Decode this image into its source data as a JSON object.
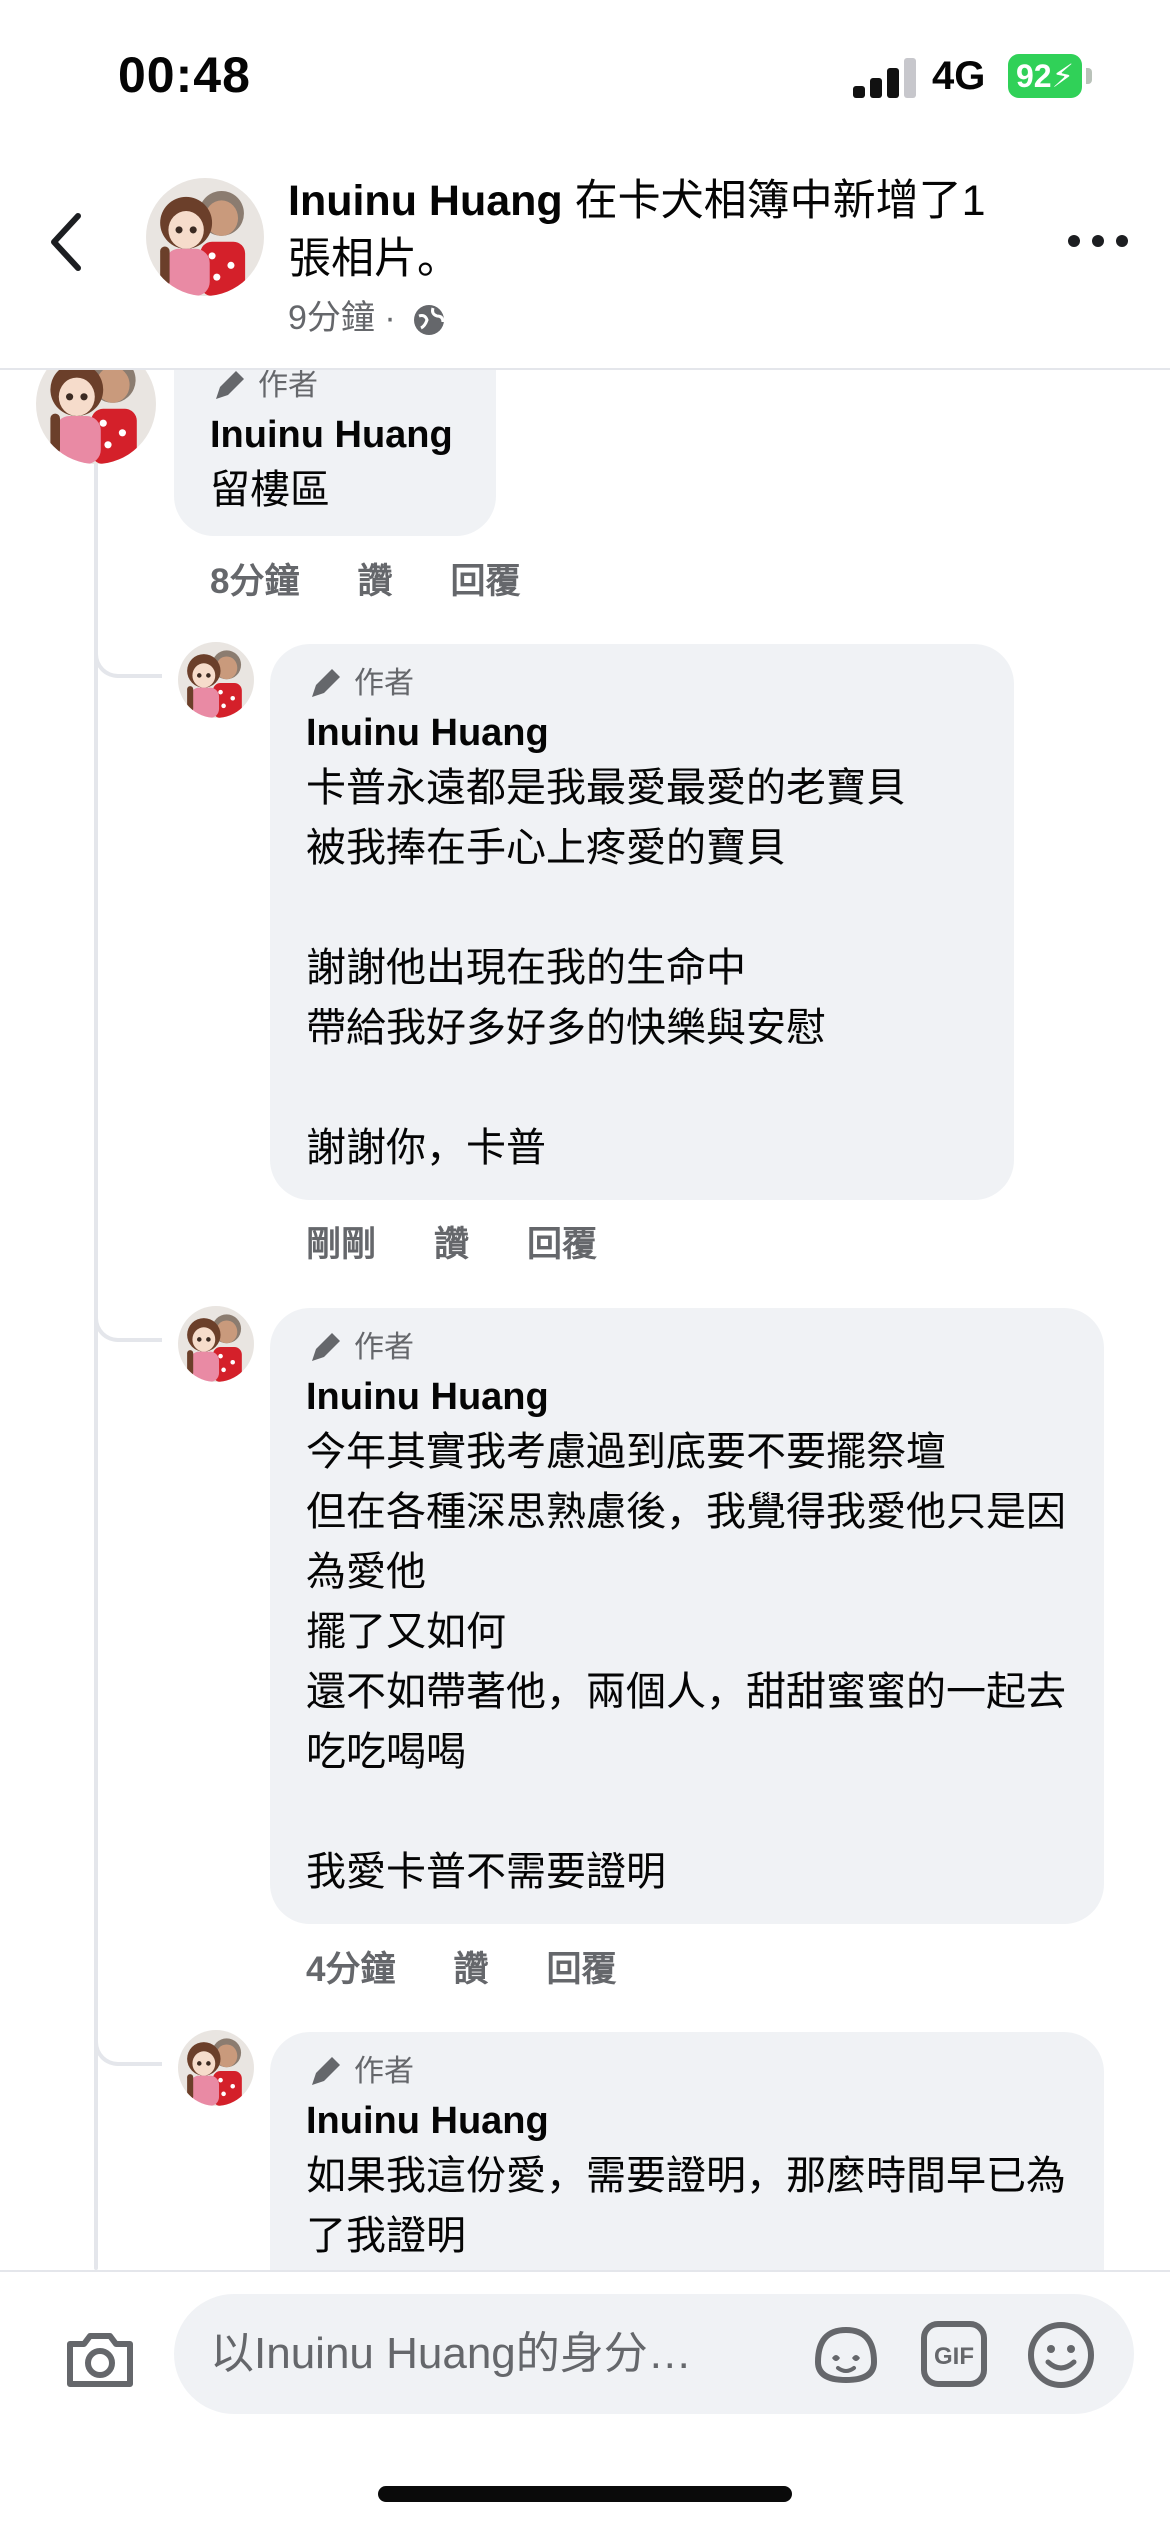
{
  "status_bar": {
    "time": "00:48",
    "network": "4G",
    "battery": "92"
  },
  "header": {
    "author": "Inuinu Huang",
    "action": " 在卡犬相簿中新增了1 張相片。",
    "time": "9分鐘",
    "separator": " · "
  },
  "comments": [
    {
      "badge": "作者",
      "name": "Inuinu Huang",
      "text": "留樓區",
      "time": "8分鐘",
      "like": "讚",
      "reply": "回覆"
    },
    {
      "badge": "作者",
      "name": "Inuinu Huang",
      "text": "卡普永遠都是我最愛最愛的老寶貝\n被我捧在手心上疼愛的寶貝\n\n謝謝他出現在我的生命中\n帶給我好多好多的快樂與安慰\n\n謝謝你，卡普",
      "time": "剛剛",
      "like": "讚",
      "reply": "回覆"
    },
    {
      "badge": "作者",
      "name": "Inuinu Huang",
      "text": "今年其實我考慮過到底要不要擺祭壇\n但在各種深思熟慮後，我覺得我愛他只是因為愛他\n擺了又如何\n還不如帶著他，兩個人，甜甜蜜蜜的一起去吃吃喝喝\n\n我愛卡普不需要證明",
      "time": "4分鐘",
      "like": "讚",
      "reply": "回覆"
    },
    {
      "badge": "作者",
      "name": "Inuinu Huang",
      "text": "如果我這份愛，需要證明，那麼時間早已為了我證明"
    }
  ],
  "composer": {
    "placeholder": "以Inuinu Huang的身分…",
    "gif_label": "GIF"
  },
  "colors": {
    "bubble": "#f0f2f5",
    "secondary_text": "#65676b",
    "battery": "#30d158"
  },
  "icons": [
    "back-arrow-icon",
    "more-icon",
    "globe-icon",
    "pencil-icon",
    "camera-icon",
    "avatar-sticker-icon",
    "gif-icon",
    "emoji-icon"
  ]
}
